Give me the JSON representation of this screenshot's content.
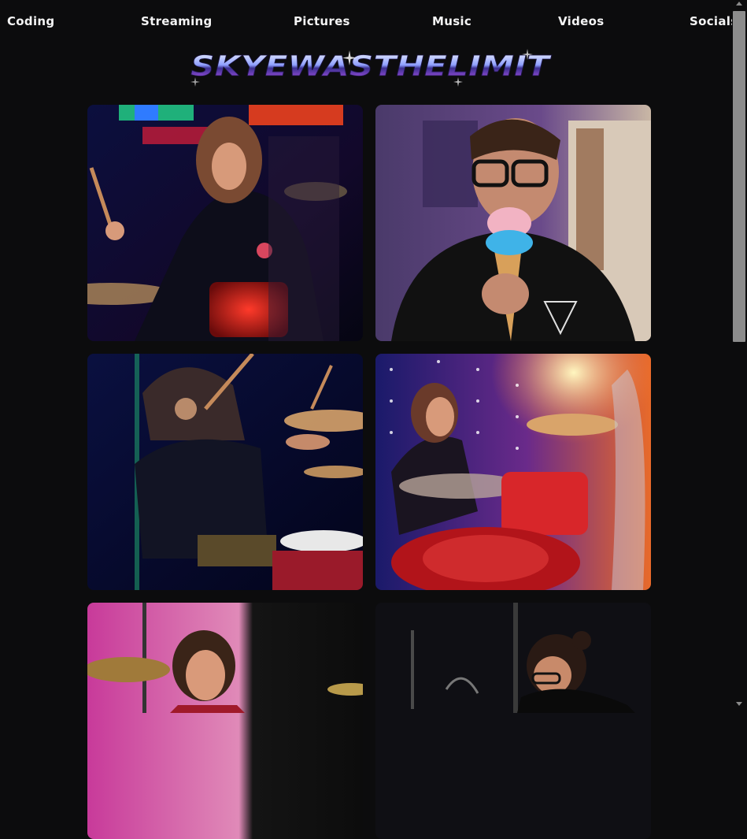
{
  "nav": {
    "items": [
      {
        "label": "Coding"
      },
      {
        "label": "Streaming"
      },
      {
        "label": "Pictures"
      },
      {
        "label": "Music"
      },
      {
        "label": "Videos"
      },
      {
        "label": "Socials"
      }
    ]
  },
  "logo": {
    "text": "SKYEWASTHELIMIT",
    "colors": {
      "top": "#e9f1ff",
      "mid": "#7f8fff",
      "bottom": "#b84cff",
      "accent": "#ff3fb0"
    }
  },
  "gallery": {
    "photos": [
      {
        "subject": "drummer with long hair under neon stage lights"
      },
      {
        "subject": "man with glasses eating a pink and blue ice cream cone"
      },
      {
        "subject": "drummer mid-stroke in blue stage light"
      },
      {
        "subject": "smiling drummer with red drum kit and warm spotlight"
      },
      {
        "subject": "smiling man with cymbals under pink light"
      },
      {
        "subject": "drummer with hair bun behind microphones"
      }
    ]
  },
  "colors": {
    "background": "#0c0c0d",
    "nav_text": "#f4f4f4",
    "scroll_thumb": "#8c8c8c"
  }
}
